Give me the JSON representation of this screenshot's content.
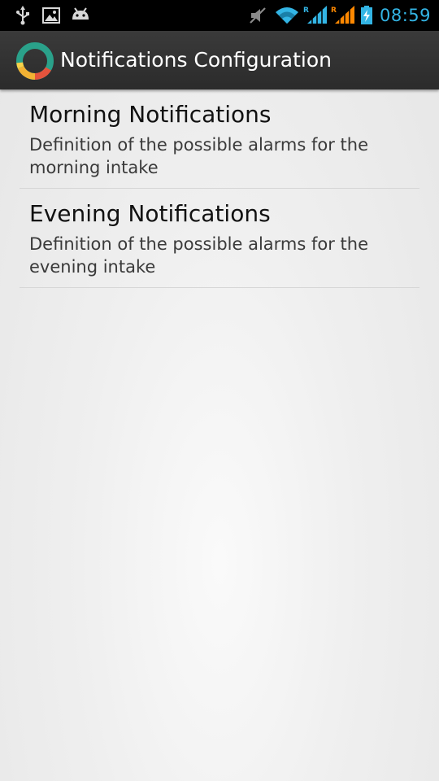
{
  "status_bar": {
    "time": "08:59",
    "left_icons": [
      "usb-icon",
      "image-icon",
      "android-icon"
    ],
    "right_icons": [
      "mute-icon",
      "wifi-icon",
      "signal-roaming-icon",
      "signal-roaming-icon-2",
      "battery-charging-icon"
    ],
    "accent_color": "#33b5e5"
  },
  "action_bar": {
    "title": "Notifications Configuration",
    "icon": "app-ring-icon"
  },
  "preferences": [
    {
      "title": "Morning Notifications",
      "summary": "Definition of the possible alarms for the morning intake"
    },
    {
      "title": "Evening Notifications",
      "summary": "Definition of the possible alarms for the evening intake"
    }
  ]
}
